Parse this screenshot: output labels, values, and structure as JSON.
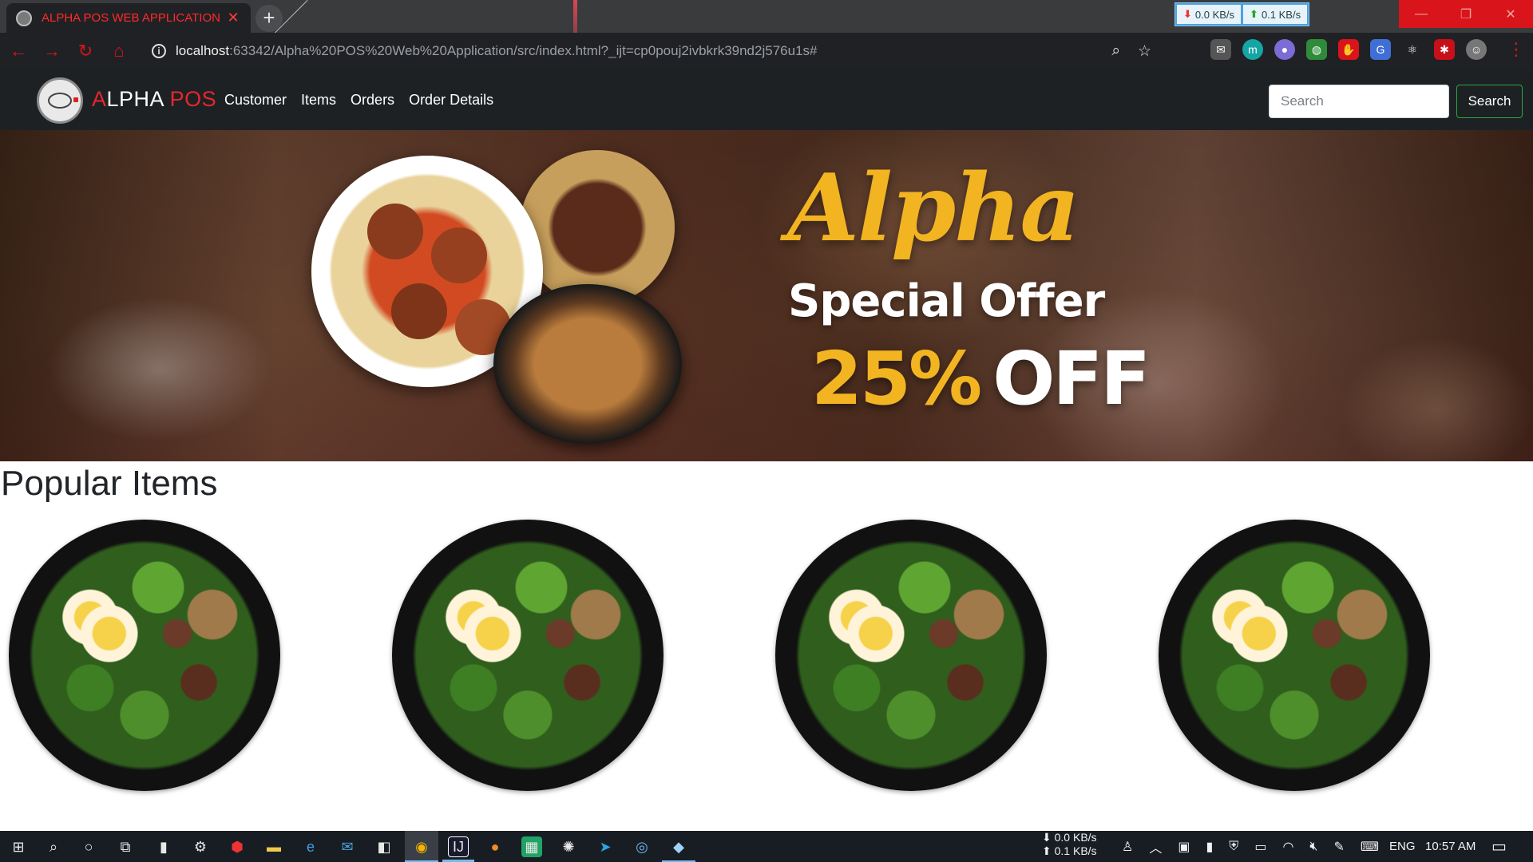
{
  "browser": {
    "tab_title": "ALPHA POS WEB APPLICATION",
    "tab_close": "✕",
    "new_tab": "+",
    "url_host": "localhost",
    "url_rest": ":63342/Alpha%20POS%20Web%20Application/src/index.html?_ijt=cp0pouj2ivbkrk39nd2j576u1s#",
    "net_down": "0.0 KB/s",
    "net_up": "0.1 KB/s"
  },
  "navbar": {
    "brand_first": "A",
    "brand_mid": "LPHA ",
    "brand_last": "POS",
    "links": [
      "Customer",
      "Items",
      "Orders",
      "Order Details"
    ],
    "search_placeholder": "Search",
    "search_button": "Search"
  },
  "hero": {
    "script_word": "Alpha",
    "headline": "Special Offer",
    "percent": "25%",
    "off": "OFF"
  },
  "popular": {
    "title": "Popular Items"
  },
  "taskbar": {
    "net_down": "0.0 KB/s",
    "net_up": "0.1 KB/s",
    "language": "ENG",
    "time": "10:57 AM"
  },
  "colors": {
    "brand_red": "#e6262d",
    "accent_gold": "#f2b421",
    "navbar_bg": "#1d2124",
    "search_border": "#28a745"
  }
}
